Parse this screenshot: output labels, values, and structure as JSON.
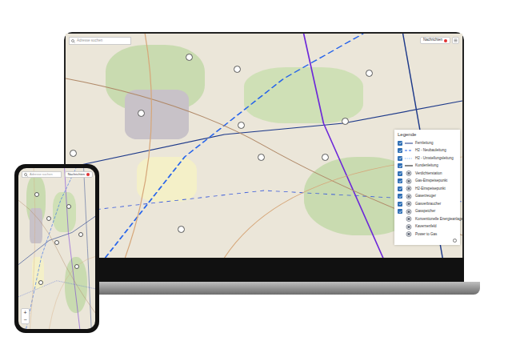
{
  "map_app": {
    "search": {
      "placeholder": "Adresse suchen"
    },
    "notifications_button": {
      "label": "Nachrichten",
      "unread": true
    },
    "legend": {
      "title": "Legende",
      "items": [
        {
          "label": "Fernleitung",
          "checked": true,
          "kind": "line",
          "line_style": "solid",
          "color": "#1e3a8a"
        },
        {
          "label": "H2 - Neubauleitung",
          "checked": true,
          "kind": "line",
          "line_style": "dashed",
          "color": "#2563eb"
        },
        {
          "label": "H2 - Umstellungsleitung",
          "checked": true,
          "kind": "line",
          "line_style": "dotted",
          "color": "#60a5fa"
        },
        {
          "label": "Kundenleitung",
          "checked": true,
          "kind": "line",
          "line_style": "solid",
          "color": "#111111"
        },
        {
          "label": "Verdichterstation",
          "checked": true,
          "kind": "icon",
          "color": "#6b7280"
        },
        {
          "label": "Gas-Einspeisepunkt",
          "checked": true,
          "kind": "icon",
          "color": "#6b7280"
        },
        {
          "label": "H2-Einspeisepunkt",
          "checked": true,
          "kind": "icon",
          "color": "#6b7280"
        },
        {
          "label": "Gaserzeuger",
          "checked": true,
          "kind": "icon",
          "color": "#6b7280"
        },
        {
          "label": "Gasverbraucher",
          "checked": true,
          "kind": "icon",
          "color": "#6b7280"
        },
        {
          "label": "Gasspeicher",
          "checked": true,
          "kind": "icon",
          "color": "#6b7280"
        },
        {
          "label": "Konventionelle Energieanlage",
          "checked": false,
          "kind": "icon",
          "color": "#6b7280"
        },
        {
          "label": "Kavernenfeld",
          "checked": false,
          "kind": "icon",
          "color": "#6b7280"
        },
        {
          "label": "Power to Gas",
          "checked": false,
          "kind": "icon",
          "color": "#6b7280"
        }
      ]
    }
  },
  "phone": {
    "zoom": [
      "+",
      "−"
    ]
  }
}
